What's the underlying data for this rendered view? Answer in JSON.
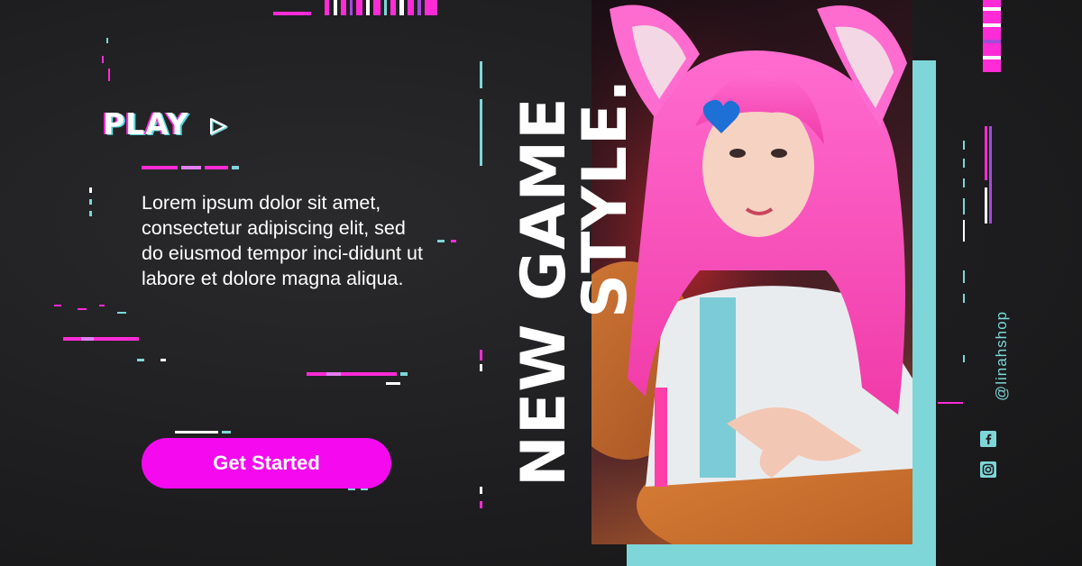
{
  "play": {
    "label": "PLAY",
    "arrow_icon": "play-triangle-icon"
  },
  "description": "Lorem ipsum dolor sit amet, consectetur adipiscing elit, sed do eiusmod tempor inci-didunt ut labore et dolore magna aliqua.",
  "cta": {
    "label": "Get Started"
  },
  "headline": {
    "line1": "NEW GAME",
    "line2": "STYLE."
  },
  "social": {
    "handle": "@linahshop",
    "facebook_icon": "facebook-icon",
    "instagram_icon": "instagram-icon"
  },
  "colors": {
    "background": "#1c1c1e",
    "accent_magenta": "#f50af0",
    "accent_teal": "#7ed6d8",
    "text": "#ffffff"
  }
}
